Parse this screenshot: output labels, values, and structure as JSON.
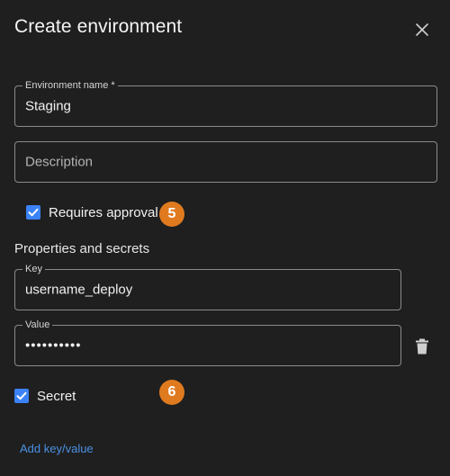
{
  "dialog": {
    "title": "Create environment",
    "close_icon": "close-icon"
  },
  "environment_name": {
    "label": "Environment name *",
    "value": "Staging"
  },
  "description": {
    "placeholder": "Description"
  },
  "requires_approval": {
    "label": "Requires approval",
    "checked": true,
    "badge": "5"
  },
  "properties": {
    "heading": "Properties and secrets",
    "key": {
      "label": "Key",
      "value": "username_deploy"
    },
    "value": {
      "label": "Value",
      "masked_value": "••••••••••"
    },
    "delete_icon": "trash-icon",
    "secret": {
      "label": "Secret",
      "checked": true
    },
    "badge": "6",
    "add_link": "Add key/value"
  },
  "colors": {
    "background": "#1f1f1f",
    "accent_blue": "#3b82f6",
    "badge_orange": "#e07a1f",
    "link_blue": "#4a90e2"
  }
}
